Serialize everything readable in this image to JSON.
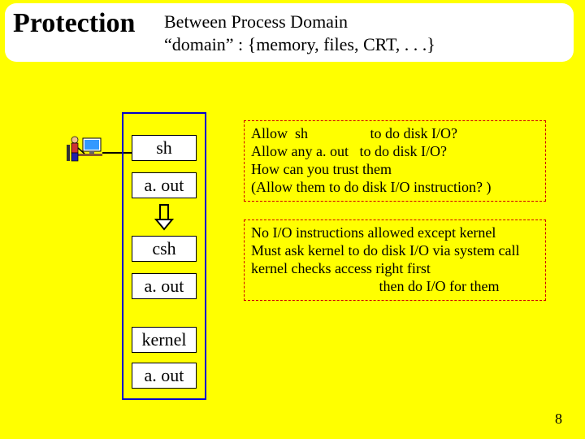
{
  "header": {
    "title": "Protection",
    "line1": "Between Process Domain",
    "line2": "“domain” :   {memory, files,  CRT, . . .}"
  },
  "processes": {
    "sh": "sh",
    "aout1": "a. out",
    "csh": "csh",
    "aout2": "a. out",
    "kernel": "kernel",
    "aout3": "a. out"
  },
  "questions": {
    "q1": "Allow  sh                 to do disk I/O?",
    "q2": "Allow any a. out   to do disk I/O?",
    "q3": "How can you trust them",
    "q4": "(Allow them to do disk I/O instruction? )"
  },
  "answers": {
    "a1": "No I/O instructions allowed except kernel",
    "a2": "Must ask kernel to do disk I/O via system call",
    "a3": "kernel checks access right first",
    "a4": "                                   then do I/O for them"
  },
  "page": "8"
}
